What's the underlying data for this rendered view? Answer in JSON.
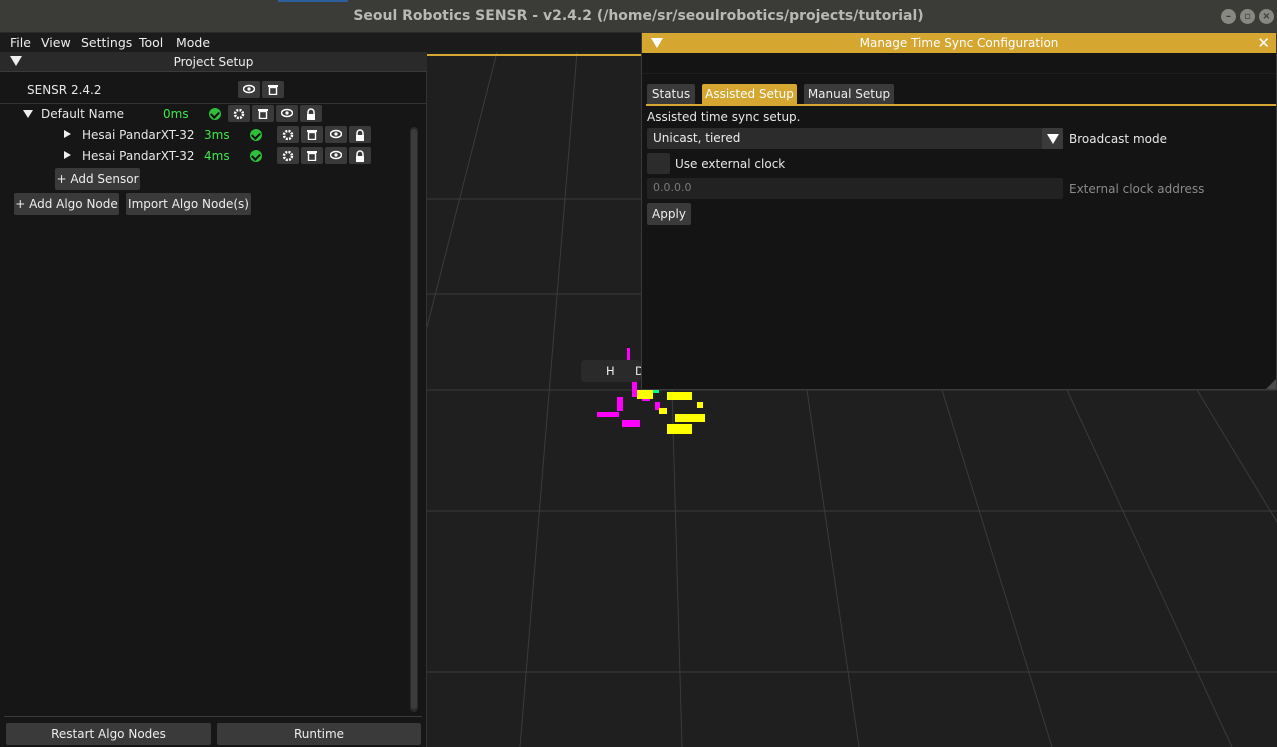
{
  "window": {
    "title": "Seoul Robotics SENSR - v2.4.2 (/home/sr/seoulrobotics/projects/tutorial)"
  },
  "menu": [
    "File",
    "View",
    "Settings",
    "Tool",
    "Mode"
  ],
  "project_setup": {
    "header": "Project Setup",
    "sensr_label": "SENSR 2.4.2",
    "node": {
      "name": "Default Name",
      "latency": "0ms"
    },
    "sensors": [
      {
        "name": "Hesai PandarXT-32",
        "latency": "3ms"
      },
      {
        "name": "Hesai PandarXT-32",
        "latency": "4ms"
      }
    ],
    "add_sensor": "+ Add Sensor",
    "add_algo_node": "+ Add Algo Node",
    "import_algo_node": "Import Algo Node(s)",
    "restart_algo_nodes": "Restart Algo Nodes",
    "runtime": "Runtime"
  },
  "viewport": {
    "overlay_label_1": "H",
    "overlay_label_2": "D"
  },
  "dialog": {
    "title": "Manage Time Sync Configuration",
    "tabs": [
      "Status",
      "Assisted Setup",
      "Manual Setup"
    ],
    "active_tab": "Assisted Setup",
    "description": "Assisted time sync setup.",
    "mode_value": "Unicast, tiered",
    "mode_label": "Broadcast mode",
    "ext_clock_label": "Use external clock",
    "ext_clock_checked": false,
    "clock_address_placeholder": "0.0.0.0",
    "clock_address_label": "External clock address",
    "apply": "Apply"
  },
  "colors": {
    "accent": "#d5a630",
    "ok_green": "#3ee84a",
    "background": "#1f1f1f"
  }
}
